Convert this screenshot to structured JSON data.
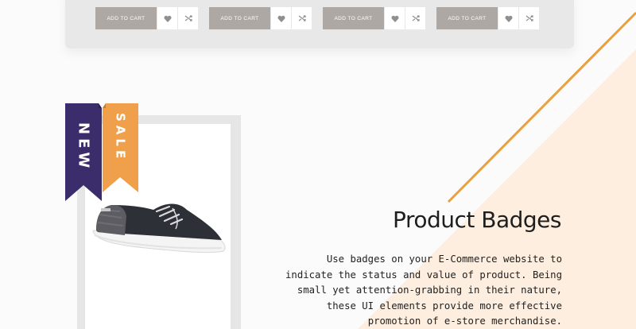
{
  "products": [
    {
      "add_to_cart": "ADD TO CART"
    },
    {
      "add_to_cart": "ADD TO CART"
    },
    {
      "add_to_cart": "ADD TO CART"
    },
    {
      "add_to_cart": "ADD TO CART"
    }
  ],
  "badges": {
    "new": "NEW",
    "sale": "SALE"
  },
  "section": {
    "title": "Product Badges",
    "description": "Use badges on your E-Commerce website to indicate the status and value of product. Being small yet attention-grabbing in their nature, these UI elements provide more effective promotion of e-store merchandise."
  },
  "colors": {
    "button_gray": "#aea8a5",
    "badge_new": "#3b2d6b",
    "badge_sale": "#f0a04b",
    "accent_line": "#e8a040",
    "peach_bg": "#fdeee0"
  },
  "icons": [
    "heart-icon",
    "shuffle-icon"
  ]
}
